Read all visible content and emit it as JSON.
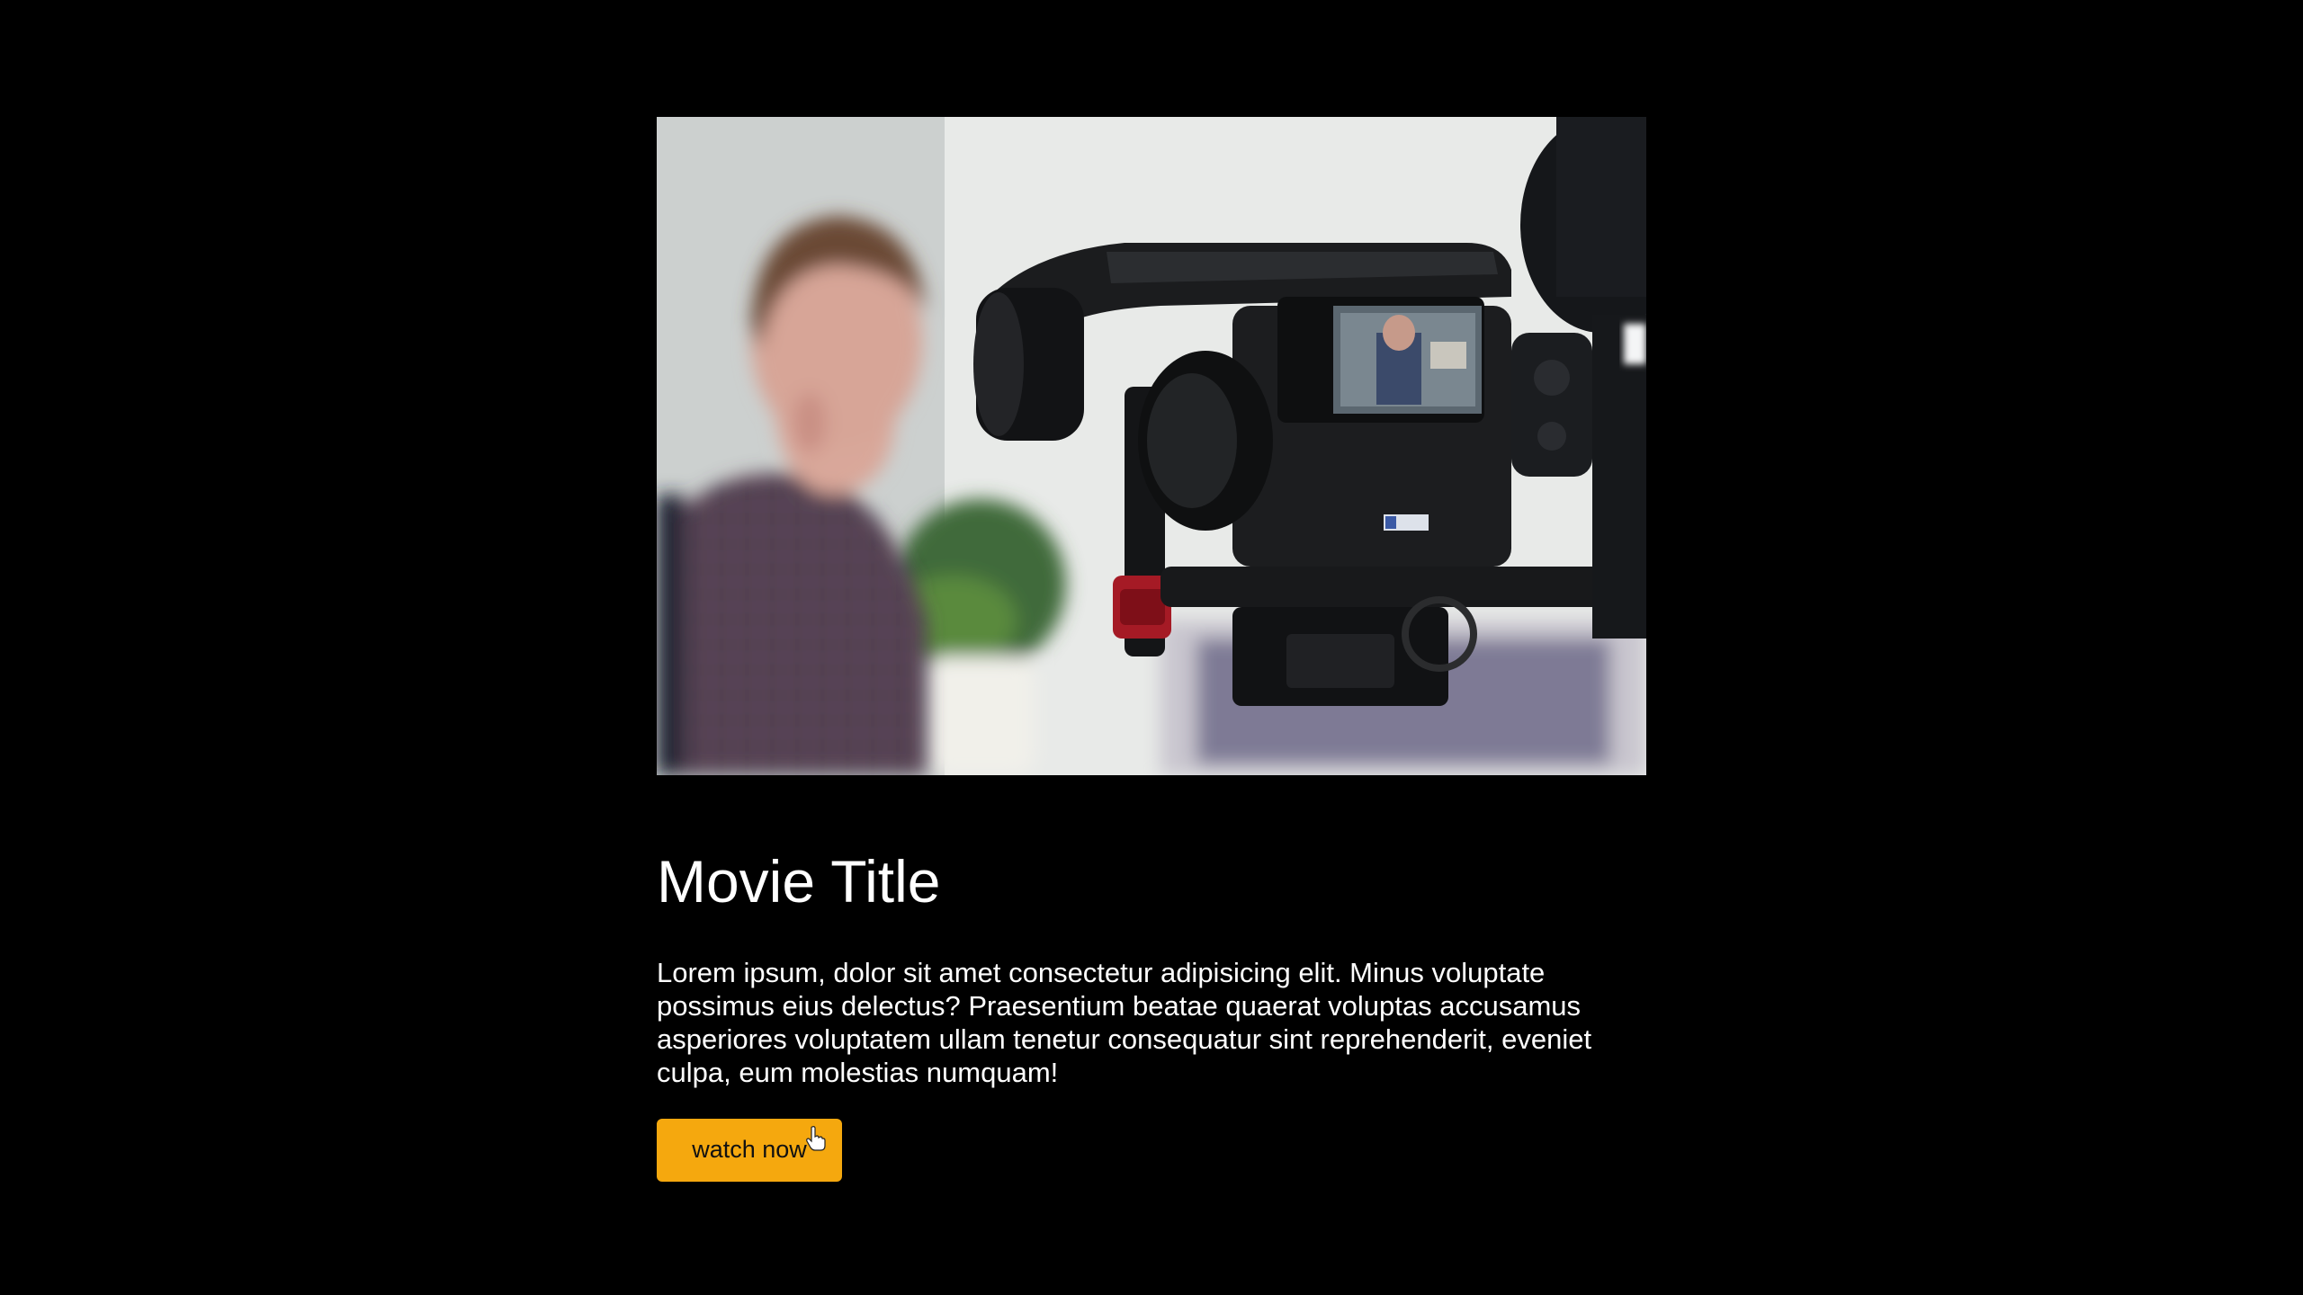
{
  "movie": {
    "title": "Movie Title",
    "description": "Lorem ipsum, dolor sit amet consectetur adipisicing elit. Minus voluptate possimus eius delectus? Praesentium beatae quaerat voluptas accusamus asperiores voluptatem ullam tenetur consequatur sint reprehenderit, eveniet culpa, eum molestias numquam!",
    "cta_label": "watch now"
  },
  "hero_image": {
    "subject": "blurred man in plaid shirt filmed by camera on gimbal stabilizer"
  },
  "colors": {
    "background": "#000000",
    "accent": "#f5a80e",
    "text": "#ffffff"
  },
  "icons": {
    "cursor": "hand-pointer-icon"
  }
}
